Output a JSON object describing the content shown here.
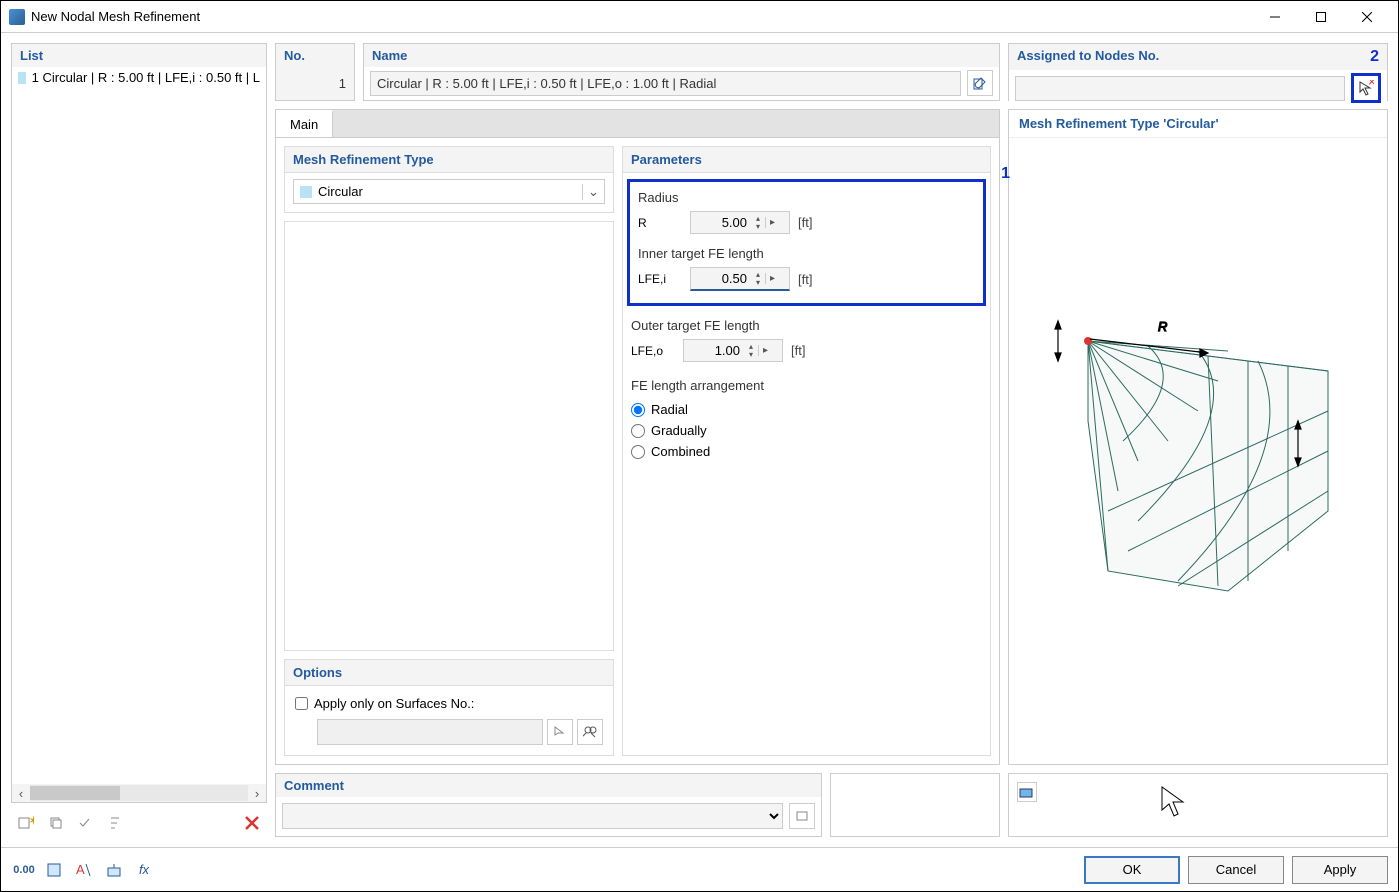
{
  "window": {
    "title": "New Nodal Mesh Refinement"
  },
  "list": {
    "header": "List",
    "items": [
      {
        "text": "1 Circular | R : 5.00 ft | LFE,i : 0.50 ft | L"
      }
    ]
  },
  "no": {
    "header": "No.",
    "value": "1"
  },
  "name": {
    "header": "Name",
    "value": "Circular | R : 5.00 ft | LFE,i : 0.50 ft | LFE,o : 1.00 ft | Radial"
  },
  "assigned": {
    "header": "Assigned to Nodes No.",
    "callout": "2",
    "value": ""
  },
  "tabs": {
    "main": "Main"
  },
  "type": {
    "header": "Mesh Refinement Type",
    "value": "Circular"
  },
  "parameters": {
    "header": "Parameters",
    "callout": "1",
    "radius": {
      "label": "Radius",
      "symbol": "R",
      "value": "5.00",
      "unit": "[ft]"
    },
    "inner": {
      "label": "Inner target FE length",
      "symbol": "LFE,i",
      "value": "0.50",
      "unit": "[ft]"
    },
    "outer": {
      "label": "Outer target FE length",
      "symbol": "LFE,o",
      "value": "1.00",
      "unit": "[ft]"
    },
    "arrangement": {
      "label": "FE length arrangement",
      "radial": "Radial",
      "gradually": "Gradually",
      "combined": "Combined"
    }
  },
  "options": {
    "header": "Options",
    "apply_surfaces": "Apply only on Surfaces No.:"
  },
  "comment": {
    "header": "Comment"
  },
  "preview": {
    "header": "Mesh Refinement Type 'Circular'"
  },
  "buttons": {
    "ok": "OK",
    "cancel": "Cancel",
    "apply": "Apply"
  }
}
